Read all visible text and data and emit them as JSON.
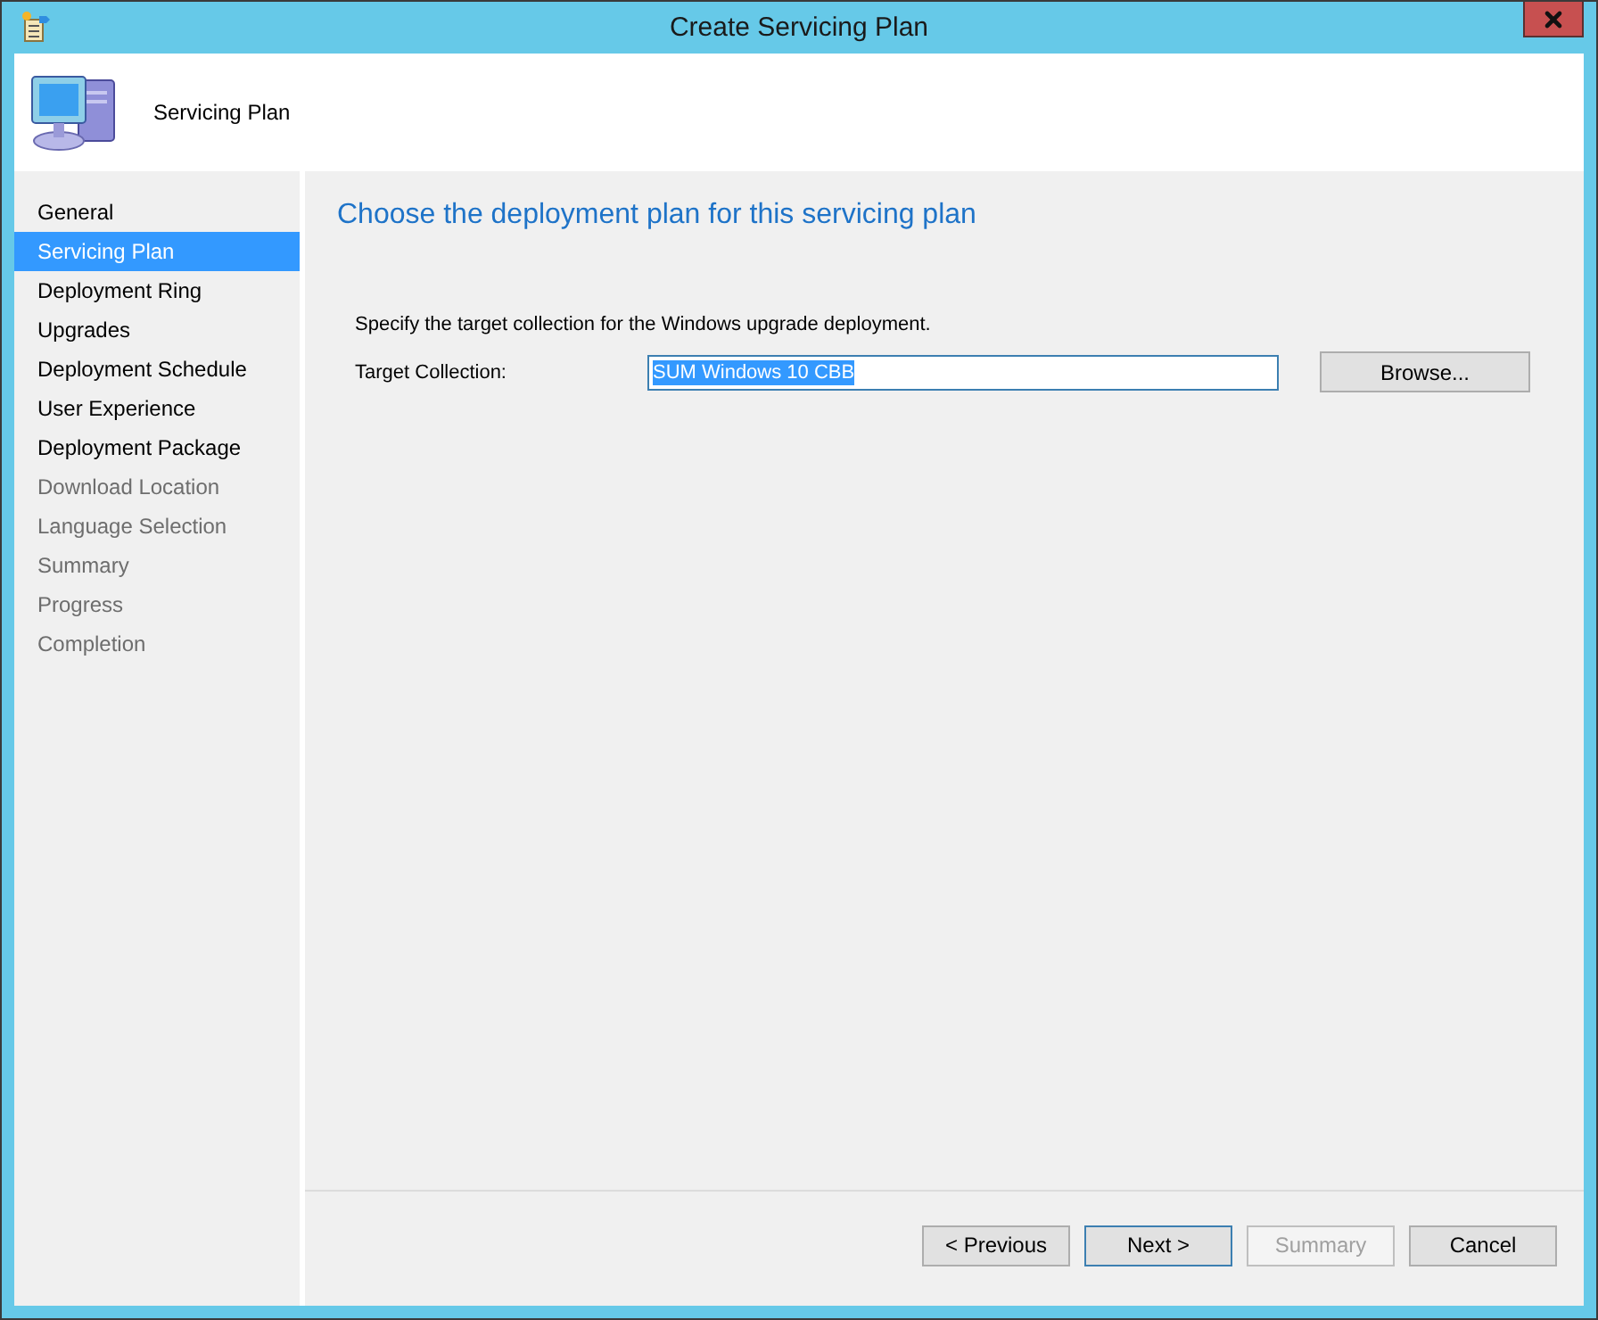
{
  "window": {
    "title": "Create Servicing Plan"
  },
  "header": {
    "title": "Servicing Plan"
  },
  "steps": [
    {
      "label": "General",
      "selected": false,
      "disabled": false
    },
    {
      "label": "Servicing Plan",
      "selected": true,
      "disabled": false
    },
    {
      "label": "Deployment Ring",
      "selected": false,
      "disabled": false
    },
    {
      "label": "Upgrades",
      "selected": false,
      "disabled": false
    },
    {
      "label": "Deployment Schedule",
      "selected": false,
      "disabled": false
    },
    {
      "label": "User Experience",
      "selected": false,
      "disabled": false
    },
    {
      "label": "Deployment Package",
      "selected": false,
      "disabled": false
    },
    {
      "label": "Download Location",
      "selected": false,
      "disabled": true
    },
    {
      "label": "Language Selection",
      "selected": false,
      "disabled": true
    },
    {
      "label": "Summary",
      "selected": false,
      "disabled": true
    },
    {
      "label": "Progress",
      "selected": false,
      "disabled": true
    },
    {
      "label": "Completion",
      "selected": false,
      "disabled": true
    }
  ],
  "page": {
    "heading": "Choose the deployment plan for this servicing plan",
    "instruction": "Specify the target collection for the Windows upgrade deployment.",
    "field_label": "Target Collection:",
    "field_value": "SUM Windows 10 CBB",
    "browse": "Browse..."
  },
  "buttons": [
    {
      "label": "< Previous",
      "disabled": false,
      "focused": false
    },
    {
      "label": "Next >",
      "disabled": false,
      "focused": true
    },
    {
      "label": "Summary",
      "disabled": true,
      "focused": false
    },
    {
      "label": "Cancel",
      "disabled": false,
      "focused": false
    }
  ]
}
